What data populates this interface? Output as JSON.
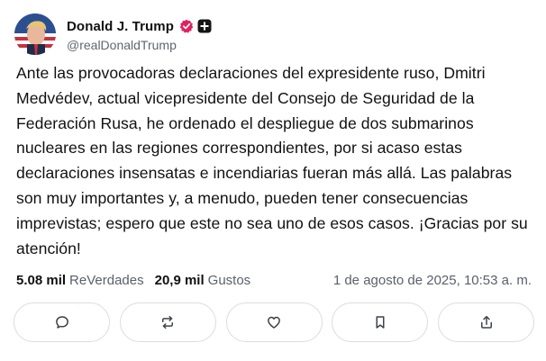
{
  "author": {
    "display_name": "Donald J. Trump",
    "handle": "@realDonaldTrump",
    "verified_icon": "verified-badge-icon",
    "extra_icon": "plus-badge-icon"
  },
  "post": {
    "text": "Ante las provocadoras declaraciones del expresidente ruso, Dmitri Medvédev, actual vicepresidente del Consejo de Seguridad de la Federación Rusa, he ordenado el despliegue de dos submarinos nucleares en las regiones correspondientes, por si acaso estas declaraciones insensatas e incendiarias fueran más allá. Las palabras son muy importantes y, a menudo, pueden tener consecuencias imprevistas; espero que este no sea uno de esos casos. ¡Gracias por su atención!"
  },
  "stats": {
    "reverdades_count": "5.08 mil",
    "reverdades_label": "ReVerdades",
    "gustos_count": "20,9 mil",
    "gustos_label": "Gustos",
    "timestamp": "1 de agosto de 2025, 10:53 a. m."
  },
  "actions": [
    {
      "name": "reply-button",
      "icon": "comment-icon"
    },
    {
      "name": "retruth-button",
      "icon": "repost-icon"
    },
    {
      "name": "like-button",
      "icon": "heart-icon"
    },
    {
      "name": "bookmark-button",
      "icon": "bookmark-icon"
    },
    {
      "name": "share-button",
      "icon": "share-icon"
    }
  ],
  "colors": {
    "verified_badge": "#e0215f",
    "text": "#111111",
    "muted": "#5a616b",
    "border": "#d9dde2"
  }
}
